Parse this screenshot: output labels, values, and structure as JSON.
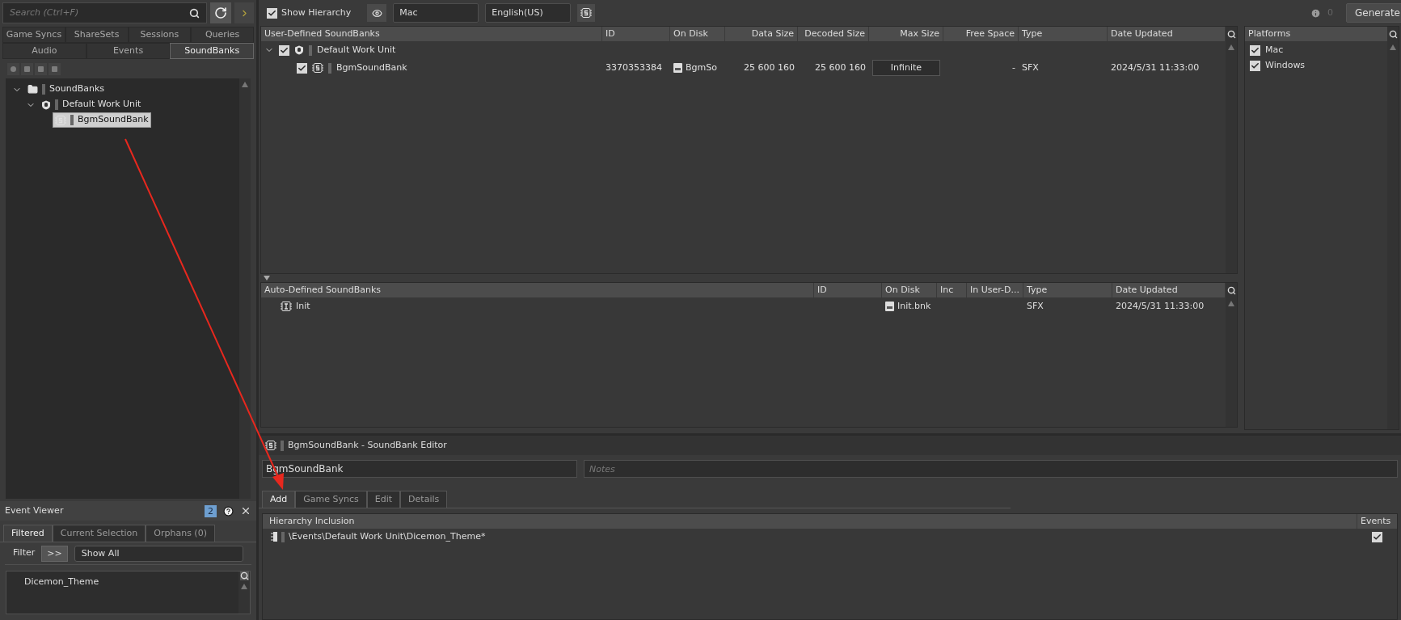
{
  "search": {
    "placeholder": "Search (Ctrl+F)"
  },
  "browser_tabs": [
    [
      {
        "label": "Game Syncs",
        "selected": false
      },
      {
        "label": "ShareSets",
        "selected": false
      },
      {
        "label": "Sessions",
        "selected": false
      },
      {
        "label": "Queries",
        "selected": false
      }
    ],
    [
      {
        "label": "Audio",
        "selected": false
      },
      {
        "label": "Events",
        "selected": false
      },
      {
        "label": "SoundBanks",
        "selected": true
      }
    ]
  ],
  "tree": [
    {
      "label": "SoundBanks",
      "kind": "folder",
      "expanded": true,
      "selected": false,
      "children": [
        {
          "label": "Default Work Unit",
          "kind": "workunit",
          "expanded": true,
          "selected": false,
          "children": [
            {
              "label": "BgmSoundBank",
              "kind": "soundbank",
              "selected": true
            }
          ]
        }
      ]
    }
  ],
  "toolbar": {
    "show_hierarchy": {
      "label": "Show Hierarchy",
      "checked": true
    },
    "platform": "Mac",
    "language": "English(US)",
    "info_count": "0",
    "generate": "Generate"
  },
  "user_table": {
    "columns": [
      {
        "label": "User-Defined SoundBanks",
        "kind": "name"
      },
      {
        "label": "ID",
        "kind": "text"
      },
      {
        "label": "On Disk",
        "kind": "file"
      },
      {
        "label": "Data Size",
        "kind": "right"
      },
      {
        "label": "Decoded Size",
        "kind": "right"
      },
      {
        "label": "Max Size",
        "kind": "field"
      },
      {
        "label": "Free Space",
        "kind": "right"
      },
      {
        "label": "Type",
        "kind": "text"
      },
      {
        "label": "Date Updated",
        "kind": "text"
      }
    ],
    "rows": [
      {
        "kind": "workunit",
        "checked": true,
        "expanded": true,
        "cells": [
          "Default Work Unit"
        ],
        "children": [
          {
            "kind": "soundbank",
            "checked": true,
            "cells": [
              "BgmSoundBank",
              "3370353384",
              "BgmSo",
              "25 600 160",
              "25 600 160",
              "Infinite",
              "-",
              "SFX",
              "2024/5/31 11:33:00"
            ]
          }
        ]
      }
    ]
  },
  "auto_table": {
    "columns": [
      {
        "label": "Auto-Defined SoundBanks",
        "kind": "name"
      },
      {
        "label": "ID",
        "kind": "text"
      },
      {
        "label": "On Disk",
        "kind": "file"
      },
      {
        "label": "Inc",
        "kind": "text"
      },
      {
        "label": "In User-D...",
        "kind": "text"
      },
      {
        "label": "Type",
        "kind": "text"
      },
      {
        "label": "Date Updated",
        "kind": "text"
      }
    ],
    "rows": [
      {
        "kind": "init",
        "cells": [
          "Init",
          "",
          "Init.bnk",
          "",
          "",
          "SFX",
          "2024/5/31 11:33:00"
        ]
      }
    ]
  },
  "platforms": {
    "title": "Platforms",
    "items": [
      {
        "label": "Mac",
        "checked": true
      },
      {
        "label": "Windows",
        "checked": true
      }
    ]
  },
  "editor": {
    "title": "BgmSoundBank - SoundBank Editor",
    "name": "BgmSoundBank",
    "notes_placeholder": "Notes",
    "tabs": [
      {
        "label": "Add",
        "selected": true
      },
      {
        "label": "Game Syncs",
        "selected": false
      },
      {
        "label": "Edit",
        "selected": false
      },
      {
        "label": "Details",
        "selected": false
      }
    ],
    "columns": [
      "Hierarchy Inclusion",
      "Events"
    ],
    "rows": [
      {
        "path": "\\Events\\Default Work Unit\\Dicemon_Theme*",
        "checked": true
      }
    ]
  },
  "event_viewer": {
    "title": "Event Viewer",
    "badge": "2",
    "tabs": [
      {
        "label": "Filtered",
        "selected": true
      },
      {
        "label": "Current Selection",
        "selected": false
      },
      {
        "label": "Orphans (0)",
        "selected": false
      }
    ],
    "filter_label": "Filter",
    "filter_button": ">>",
    "filter_value": "Show All",
    "items": [
      "Dicemon_Theme"
    ]
  }
}
